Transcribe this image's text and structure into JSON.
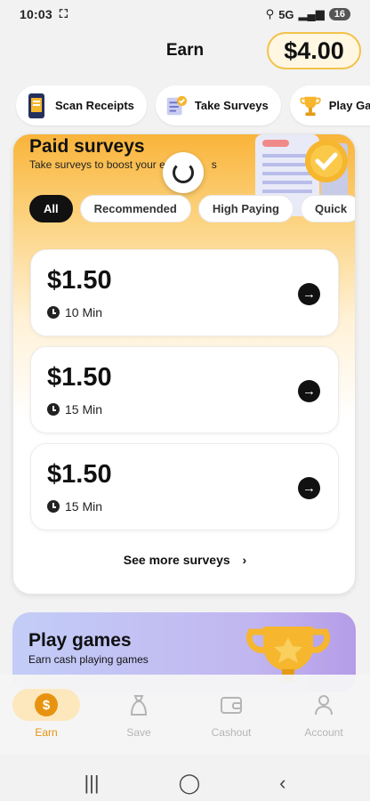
{
  "status_bar": {
    "time": "10:03",
    "network": "5G",
    "battery": "16"
  },
  "header": {
    "title": "Earn",
    "balance": "$4.00"
  },
  "categories": [
    {
      "label": "Scan Receipts",
      "icon": "receipt-phone-icon"
    },
    {
      "label": "Take Surveys",
      "icon": "survey-clipboard-icon"
    },
    {
      "label": "Play Games",
      "icon": "trophy-icon"
    }
  ],
  "surveys": {
    "title": "Paid surveys",
    "subtitle": "Take surveys to boost your e",
    "subtitle_tail": "s",
    "filters": [
      "All",
      "Recommended",
      "High Paying",
      "Quick"
    ],
    "active_filter": "All",
    "items": [
      {
        "price": "$1.50",
        "duration": "10 Min"
      },
      {
        "price": "$1.50",
        "duration": "15 Min"
      },
      {
        "price": "$1.50",
        "duration": "15 Min"
      }
    ],
    "see_more": "See more surveys"
  },
  "games": {
    "title": "Play games",
    "subtitle": "Earn cash playing games"
  },
  "bottom_nav": [
    {
      "label": "Earn",
      "icon": "dollar-coin-icon",
      "active": true
    },
    {
      "label": "Save",
      "icon": "piggy-bag-icon",
      "active": false
    },
    {
      "label": "Cashout",
      "icon": "wallet-icon",
      "active": false
    },
    {
      "label": "Account",
      "icon": "person-icon",
      "active": false
    }
  ],
  "colors": {
    "accent": "#e8930f",
    "balance_border": "#f3c24a",
    "survey_gradient": "#f9b43a",
    "games_gradient": "#c1b6f0"
  }
}
